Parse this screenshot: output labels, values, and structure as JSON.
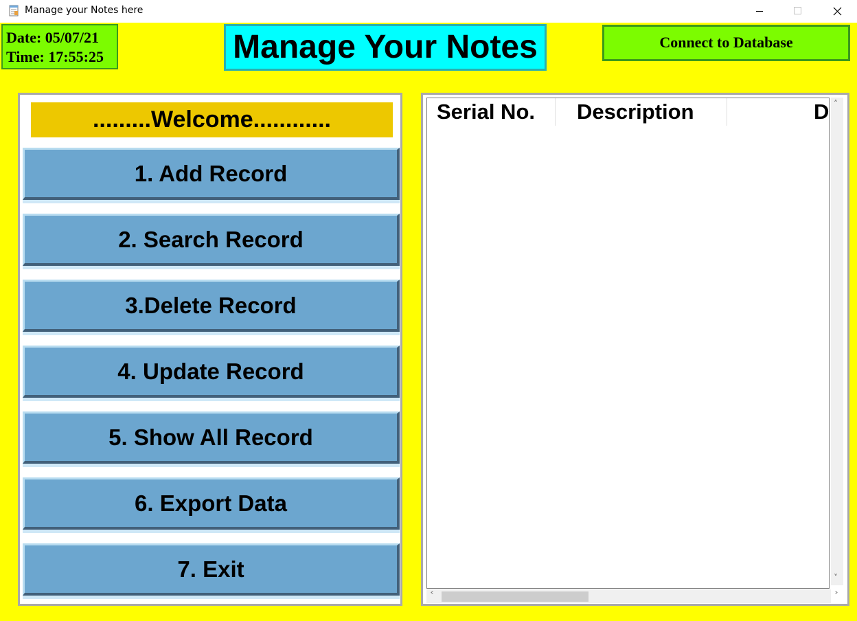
{
  "window": {
    "title": "Manage your Notes here",
    "controls": {
      "minimize": "minimize-icon",
      "maximize": "maximize-icon",
      "close": "close-icon"
    }
  },
  "colors": {
    "background": "#ffff00",
    "datetime_bg": "#7cfc00",
    "title_bg": "#00ffff",
    "welcome_bg": "#edc800",
    "menu_button_bg": "#6ca6cf"
  },
  "header": {
    "date_label": "Date: 05/07/21",
    "time_label": "Time: 17:55:25",
    "app_title": "Manage Your Notes",
    "connect_button": "Connect to Database"
  },
  "menu": {
    "welcome": ".........Welcome............",
    "items": [
      {
        "label": "1. Add Record"
      },
      {
        "label": "2. Search Record"
      },
      {
        "label": "3.Delete Record"
      },
      {
        "label": "4. Update Record"
      },
      {
        "label": "5. Show All Record"
      },
      {
        "label": "6. Export Data"
      },
      {
        "label": "7. Exit"
      }
    ]
  },
  "table": {
    "columns": [
      "Serial No.",
      "Description",
      "D"
    ],
    "rows": []
  }
}
